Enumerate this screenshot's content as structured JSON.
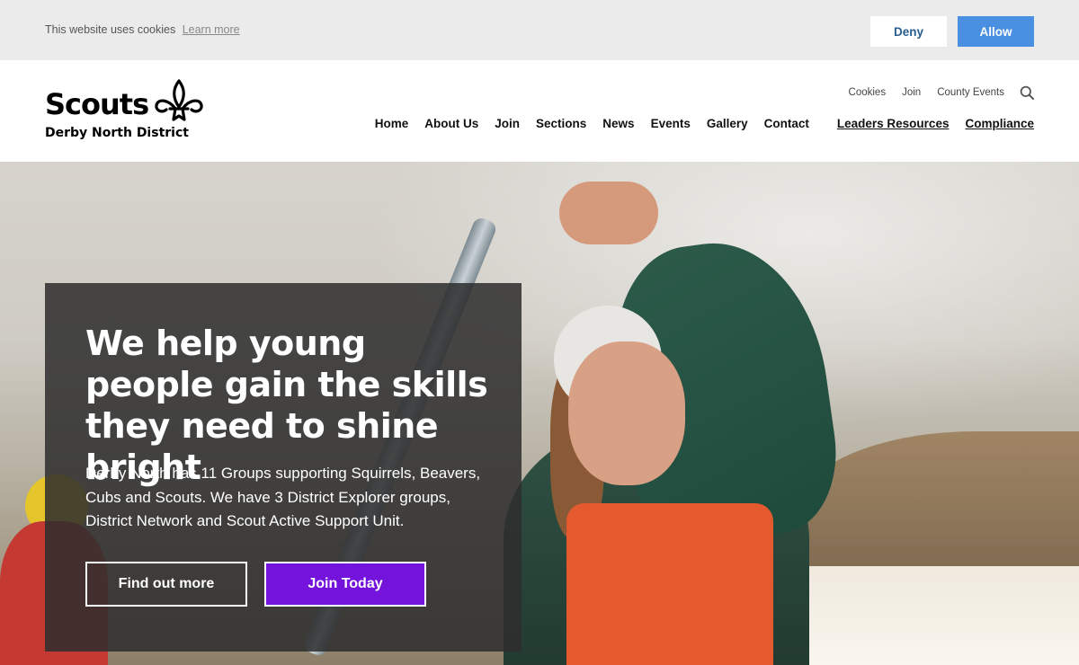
{
  "cookie_bar": {
    "message": "This website uses cookies",
    "learn_more": "Learn more",
    "deny_label": "Deny",
    "allow_label": "Allow"
  },
  "header": {
    "logo_word": "Scouts",
    "logo_subtitle": "Derby North District",
    "utility_nav": [
      "Cookies",
      "Join",
      "County Events"
    ],
    "main_nav": [
      "Home",
      "About Us",
      "Join",
      "Sections",
      "News",
      "Events",
      "Gallery",
      "Contact"
    ],
    "secondary_nav": [
      "Leaders Resources",
      "Compliance"
    ]
  },
  "hero": {
    "title": "We help young people gain the skills they need to shine bright",
    "text": "Derby North has 11 Groups supporting Squirrels, Beavers, Cubs and Scouts. We have 3 District Explorer groups, District Network and Scout Active Support Unit.",
    "find_out_more": "Find out more",
    "join_today": "Join Today"
  },
  "colors": {
    "accent_purple": "#7413dc",
    "allow_blue": "#4a90e2",
    "cookie_bg": "#ebebeb"
  }
}
